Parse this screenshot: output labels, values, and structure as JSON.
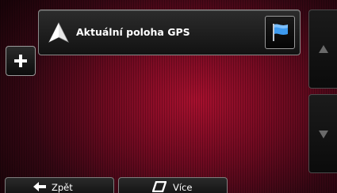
{
  "route": {
    "start_label": "Aktuální poloha GPS",
    "start_icon": "navigation-arrow-icon",
    "destination_icon": "flag-icon"
  },
  "actions": {
    "add_icon": "plus-icon",
    "scroll_up_icon": "triangle-up-icon",
    "scroll_down_icon": "triangle-down-icon"
  },
  "bottom_bar": {
    "back_label": "Zpět",
    "back_icon": "arrow-left-icon",
    "more_label": "Více",
    "more_icon": "more-icon"
  },
  "colors": {
    "background_center": "#a8102e",
    "background_edge": "#1a0409",
    "flag": "#3d9bf0",
    "button_dark": "#121212"
  }
}
